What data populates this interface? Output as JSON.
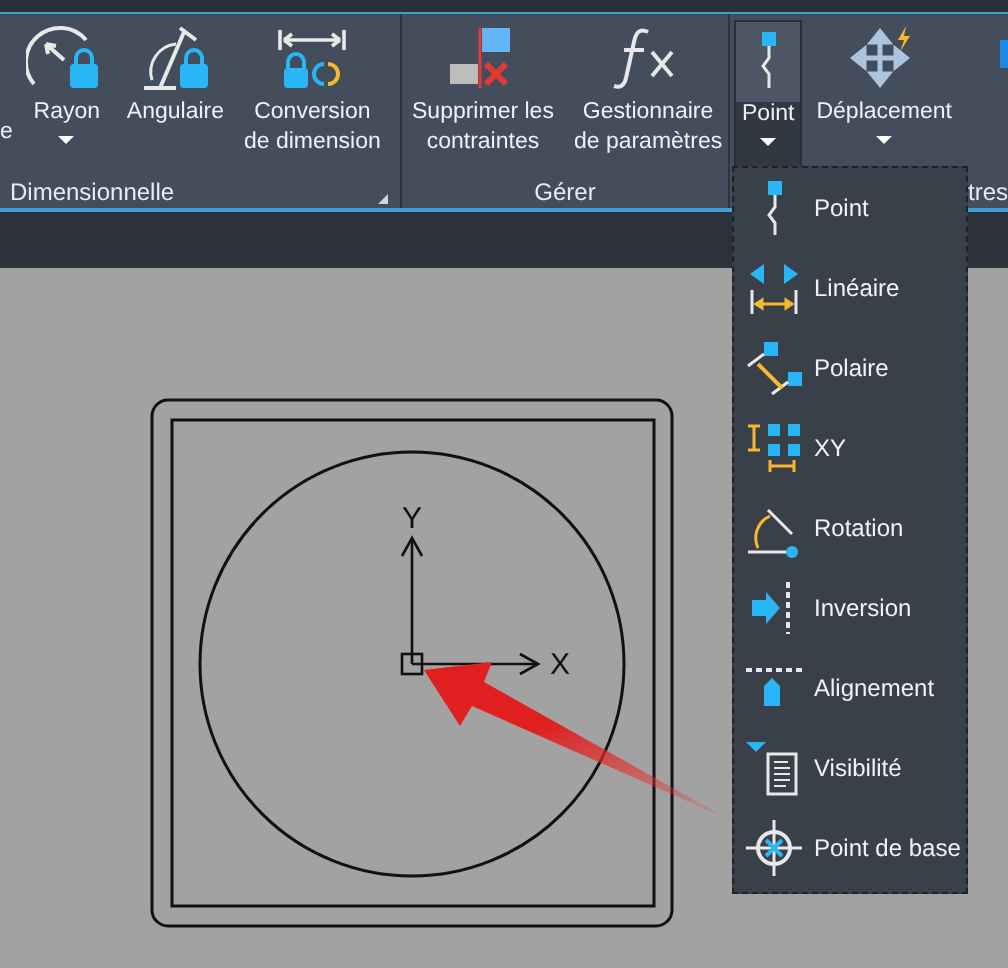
{
  "ribbon": {
    "panels": [
      {
        "title": "Dimensionnelle",
        "launcher": true,
        "buttons": [
          {
            "lines": [
              "e"
            ],
            "kind": "cut",
            "dropdown": false,
            "expanded": false
          },
          {
            "lines": [
              "Rayon"
            ],
            "kind": "radius",
            "dropdown": true,
            "expanded": false
          },
          {
            "lines": [
              "Angulaire"
            ],
            "kind": "angular",
            "dropdown": false,
            "expanded": false
          },
          {
            "lines": [
              "Conversion",
              "de dimension"
            ],
            "kind": "convert",
            "dropdown": false,
            "expanded": false
          }
        ]
      },
      {
        "title": "Gérer",
        "launcher": false,
        "buttons": [
          {
            "lines": [
              "Supprimer les",
              "contraintes"
            ],
            "kind": "delete",
            "dropdown": false,
            "expanded": false
          },
          {
            "lines": [
              "Gestionnaire",
              "de paramètres"
            ],
            "kind": "fx",
            "dropdown": false,
            "expanded": false
          }
        ]
      },
      {
        "title": "tres",
        "launcher": false,
        "buttons": [
          {
            "lines": [
              "Point"
            ],
            "kind": "point",
            "dropdown": true,
            "expanded": true
          },
          {
            "lines": [
              "Déplacement"
            ],
            "kind": "move",
            "dropdown": true,
            "expanded": false
          },
          {
            "kind": "partial",
            "dropdown": false,
            "expanded": false
          }
        ]
      }
    ]
  },
  "menu": {
    "items": [
      {
        "label": "Point",
        "kind": "point"
      },
      {
        "label": "Linéaire",
        "kind": "linear"
      },
      {
        "label": "Polaire",
        "kind": "polar"
      },
      {
        "label": "XY",
        "kind": "xy"
      },
      {
        "label": "Rotation",
        "kind": "rotation"
      },
      {
        "label": "Inversion",
        "kind": "inversion"
      },
      {
        "label": "Alignement",
        "kind": "alignment"
      },
      {
        "label": "Visibilité",
        "kind": "visibility"
      },
      {
        "label": "Point de base",
        "kind": "basepoint"
      }
    ]
  },
  "drawing": {
    "y_axis_label": "Y",
    "x_axis_label": "X"
  }
}
